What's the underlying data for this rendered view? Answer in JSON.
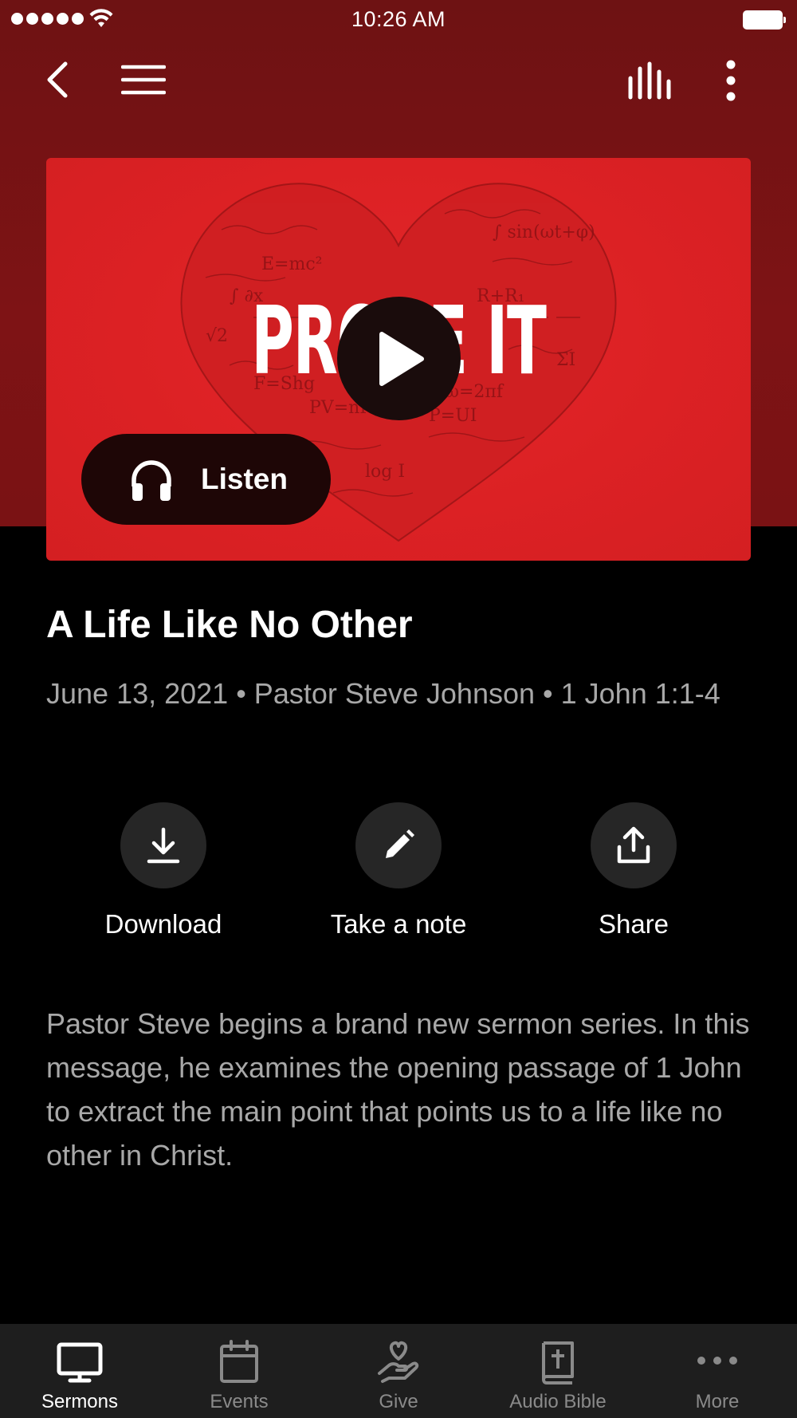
{
  "status_bar": {
    "time": "10:26 AM"
  },
  "nav": {
    "back_icon": "chevron-left-icon",
    "menu_icon": "hamburger-menu-icon",
    "audio_icon": "equalizer-icon",
    "more_icon": "vertical-dots-icon"
  },
  "artwork": {
    "series_title": "PROVE IT",
    "listen_label": "Listen"
  },
  "sermon": {
    "title": "A Life Like No Other",
    "meta": "June 13, 2021 • Pastor Steve Johnson • 1 John 1:1-4",
    "description": "Pastor Steve begins a brand new sermon series. In this message, he examines the opening passage of 1 John to extract the main point that points us to a life like no other in Christ."
  },
  "actions": [
    {
      "label": "Download",
      "icon": "download-icon"
    },
    {
      "label": "Take a note",
      "icon": "pencil-icon"
    },
    {
      "label": "Share",
      "icon": "share-icon"
    }
  ],
  "tabs": [
    {
      "label": "Sermons",
      "icon": "monitor-icon",
      "active": true
    },
    {
      "label": "Events",
      "icon": "calendar-icon",
      "active": false
    },
    {
      "label": "Give",
      "icon": "hand-heart-icon",
      "active": false
    },
    {
      "label": "Audio Bible",
      "icon": "bible-icon",
      "active": false
    },
    {
      "label": "More",
      "icon": "horizontal-dots-icon",
      "active": false
    }
  ],
  "colors": {
    "header_red": "#7a1214",
    "art_red": "#dc2124",
    "tab_active": "#ffffff",
    "tab_inactive": "#8a8a8a",
    "meta_gray": "#a8a8a8"
  }
}
